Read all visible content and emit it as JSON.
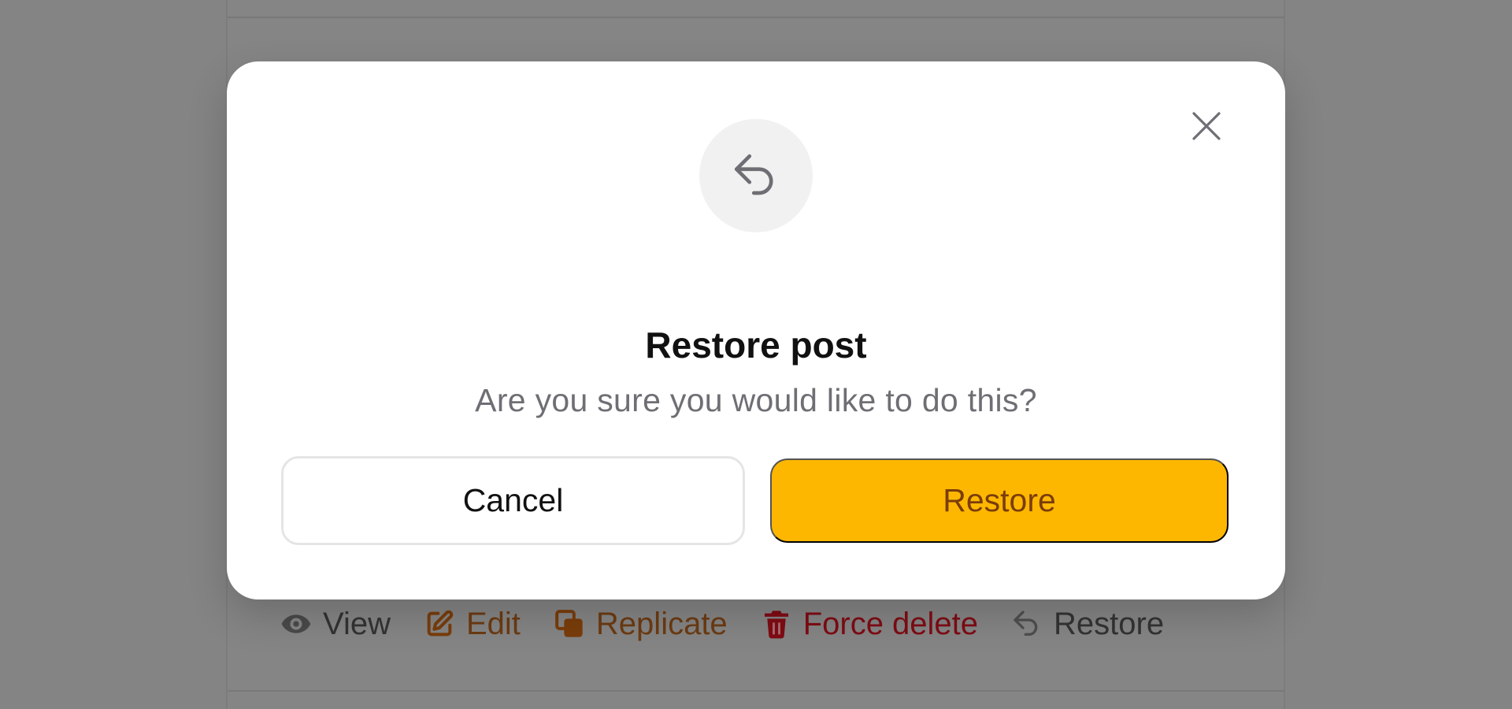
{
  "colors": {
    "overlay": "#848484",
    "modal_bg": "#ffffff",
    "primary": "#feb701",
    "primary_text": "#7a3d0a",
    "danger_text": "#800b14"
  },
  "row_actions": [
    {
      "label": "View",
      "icon": "eye-icon"
    },
    {
      "label": "Edit",
      "icon": "pencil-square-icon"
    },
    {
      "label": "Replicate",
      "icon": "copy-icon"
    },
    {
      "label": "Force delete",
      "icon": "trash-icon"
    },
    {
      "label": "Restore",
      "icon": "undo-arrow-icon"
    }
  ],
  "modal": {
    "icon": "undo-arrow-icon",
    "close_icon": "close-icon",
    "title": "Restore post",
    "description": "Are you sure you would like to do this?",
    "cancel_label": "Cancel",
    "confirm_label": "Restore"
  }
}
